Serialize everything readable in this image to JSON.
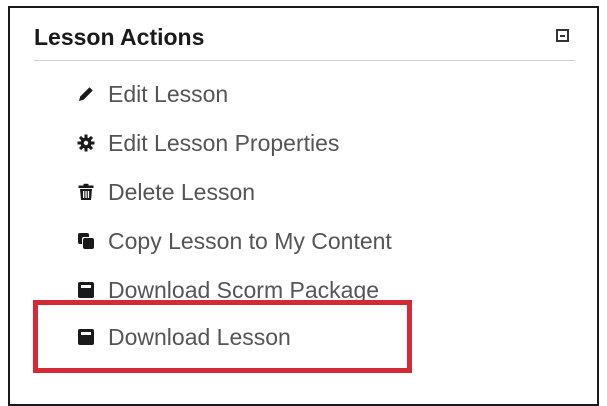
{
  "panel": {
    "title": "Lesson Actions"
  },
  "actions": [
    {
      "label": "Edit Lesson",
      "icon": "pencil-icon"
    },
    {
      "label": "Edit Lesson Properties",
      "icon": "gear-icon"
    },
    {
      "label": "Delete Lesson",
      "icon": "trash-icon"
    },
    {
      "label": "Copy Lesson to My Content",
      "icon": "copy-icon"
    },
    {
      "label": "Download Scorm Package",
      "icon": "download-box-icon"
    }
  ],
  "highlighted_action": {
    "label": "Download Lesson",
    "icon": "download-box-icon"
  },
  "colors": {
    "highlight_border": "#d42a35",
    "label_text": "#555555",
    "title_text": "#1a1a1a"
  }
}
